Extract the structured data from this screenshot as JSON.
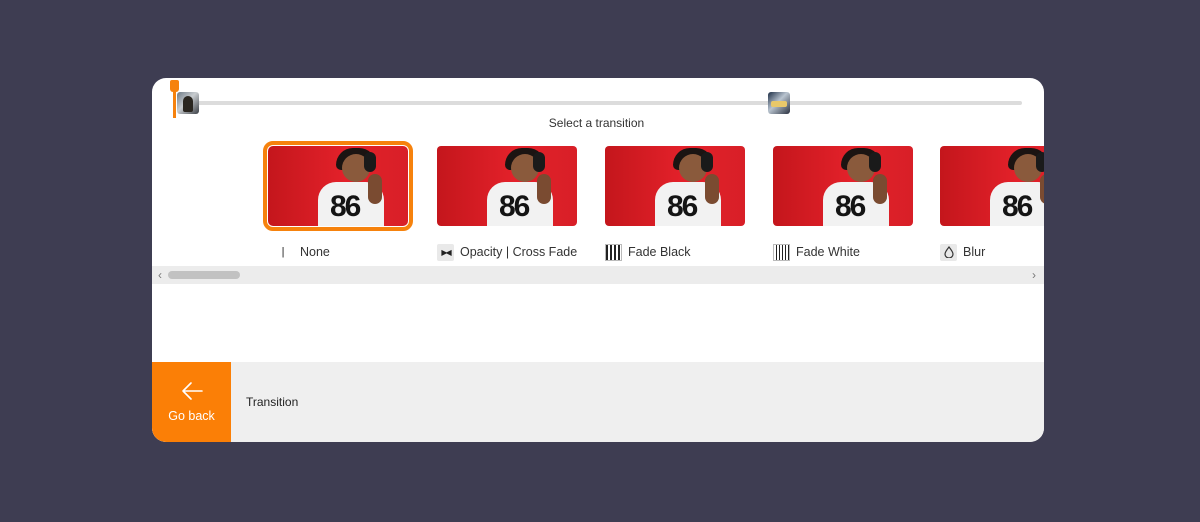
{
  "timeline": {
    "clips": [
      {
        "icon": "person-clip-thumbnail"
      },
      {
        "icon": "desk-clip-thumbnail"
      }
    ]
  },
  "section_title": "Select a transition",
  "transitions": [
    {
      "label": "None",
      "icon": "none-icon",
      "icon_glyph": "|",
      "selected": true
    },
    {
      "label": "Opacity | Cross Fade",
      "icon": "cross-fade-icon",
      "icon_glyph": "▶◀",
      "selected": false
    },
    {
      "label": "Fade Black",
      "icon": "fade-black-icon",
      "selected": false
    },
    {
      "label": "Fade White",
      "icon": "fade-white-icon",
      "selected": false
    },
    {
      "label": "Blur",
      "icon": "blur-icon",
      "icon_glyph": "💧",
      "selected": false
    }
  ],
  "thumbnail_shirt_text": "86",
  "scrollbar": {
    "left_arrow": "‹",
    "right_arrow": "›"
  },
  "bottom_bar": {
    "go_back_label": "Go back",
    "title": "Transition"
  },
  "colors": {
    "accent": "#fb7f06",
    "background": "#3e3d52",
    "panel": "#ffffff",
    "bottom_bar": "#efefef"
  }
}
